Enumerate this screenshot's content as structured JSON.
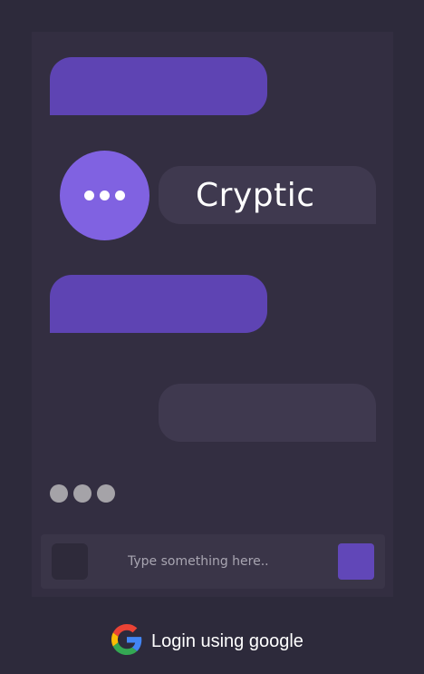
{
  "app": {
    "brand_name": "Cryptic"
  },
  "composer": {
    "placeholder": "Type something here.."
  },
  "login": {
    "label": "Login using google",
    "icon": "google-icon"
  },
  "colors": {
    "background": "#2d2a3b",
    "panel": "#332e41",
    "bubble_purple": "#5e44b3",
    "bubble_gray": "#3f394f",
    "avatar": "#8062e1",
    "send_button": "#6147b8"
  }
}
